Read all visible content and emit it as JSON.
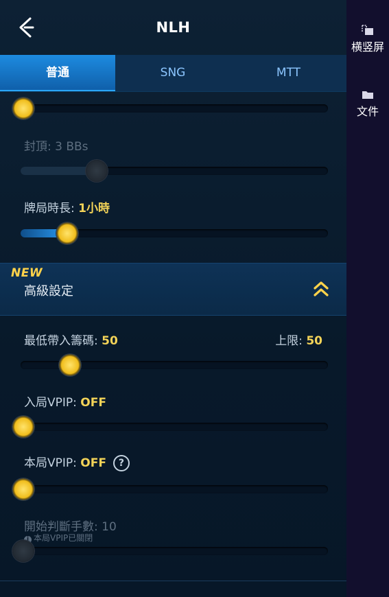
{
  "header": {
    "title": "NLH"
  },
  "tabs": [
    {
      "label": "普通",
      "active": true
    },
    {
      "label": "SNG",
      "active": false
    },
    {
      "label": "MTT",
      "active": false
    }
  ],
  "settings": {
    "cap": {
      "label": "封頂: ",
      "value": "3 BBs",
      "level": 0.25,
      "enabled": false
    },
    "duration": {
      "label": "牌局時長: ",
      "value": "1小時",
      "level": 0.15,
      "enabled": true
    },
    "top_slider": {
      "level": 0.0,
      "enabled": true
    }
  },
  "advanced": {
    "badge": "NEW",
    "title": "高級設定",
    "min_buyin": {
      "label": "最低帶入籌碼: ",
      "value": "50",
      "level": 0.16
    },
    "max_buyin": {
      "label": "上限: ",
      "value": "50"
    },
    "entry_vpip": {
      "label": "入局VPIP: ",
      "value": "OFF",
      "level": 0.0
    },
    "hand_vpip": {
      "label": "本局VPIP: ",
      "value": "OFF",
      "level": 0.0,
      "help": "?"
    },
    "start_hands": {
      "label": "開始判斷手數: ",
      "value": "10",
      "level": 0.0,
      "enabled": false,
      "note": "本局VPIP已關閉",
      "note_icon": "i"
    }
  },
  "sidebar": {
    "items": [
      {
        "label": "横竖屏",
        "icon": "rotate-icon"
      },
      {
        "label": "文件",
        "icon": "folder-icon"
      }
    ]
  },
  "colors": {
    "accent": "#f3d358",
    "tab_active": "#1d8be0",
    "sidebar_bg": "#120f2d"
  }
}
